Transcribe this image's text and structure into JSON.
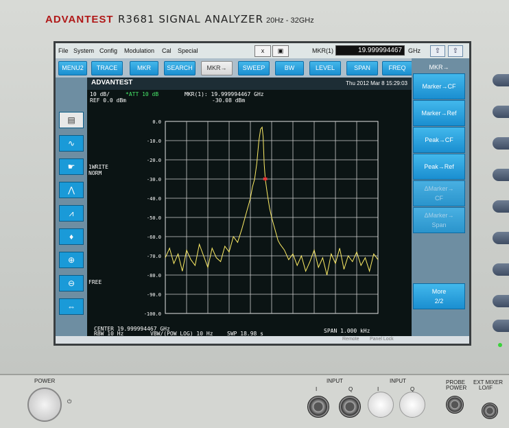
{
  "instrument": {
    "brand": "ADVANTEST",
    "model": "R3681  SIGNAL  ANALYZER",
    "freq_range": "20Hz - 32GHz"
  },
  "menubar": {
    "items": [
      "File",
      "System",
      "Config",
      "Modulation",
      "Cal",
      "Special"
    ],
    "close_label": "x",
    "save_label": "▣",
    "marker_label": "MKR(1)",
    "marker_value": "19.999994467",
    "marker_unit": "GHz",
    "arrow_left": "⇧",
    "arrow_right": "⇧"
  },
  "softkeys": [
    "MENU2",
    "TRACE",
    "MKR",
    "SEARCH",
    "MKR→",
    "SWEEP",
    "BW",
    "LEVEL",
    "SPAN",
    "FREQ"
  ],
  "right_panel": {
    "header": "MKR→",
    "keys": [
      "Marker→CF",
      "Marker→Ref",
      "Peak→CF",
      "Peak→Ref"
    ],
    "disabled_keys": [
      {
        "line1": "ΔMarker→",
        "line2": "CF"
      },
      {
        "line1": "ΔMarker→",
        "line2": "Span"
      }
    ],
    "more": {
      "line1": "More",
      "line2": "2/2"
    }
  },
  "display": {
    "logo": "ADVANTEST",
    "datetime": "Thu 2012 Mar 8 15:29:03",
    "scale": "10 dB/",
    "ref": "REF 0.0 dBm",
    "att": "*ATT 10 dB",
    "mkr_line1": "MKR(1): 19.999994467 GHz",
    "mkr_line2": "-30.08 dBm",
    "trace_mode_1": "1WRITE",
    "trace_mode_2": "NORM",
    "free": "FREE",
    "center": "CENTER 19.999994467 GHz",
    "rbw": "RBW 10 Hz",
    "vbw": "VBW/(POW_LOG) 10 Hz",
    "swp": "SWP 18.98 s",
    "span": "SPAN 1.000 kHz",
    "y_ticks": [
      "0.0",
      "-10.0",
      "-20.0",
      "-30.0",
      "-40.0",
      "-50.0",
      "-60.0",
      "-70.0",
      "-80.0",
      "-90.0",
      "-100.0"
    ]
  },
  "status_bar": {
    "remote": "Remote",
    "panel_lock": "Panel Lock"
  },
  "chart_data": {
    "type": "line",
    "x_ticks": [],
    "ylim": [
      -100,
      0
    ],
    "grid": true,
    "series_color": "#ffee66",
    "trace_points": [
      [
        0,
        -71
      ],
      [
        2,
        -66
      ],
      [
        4,
        -74
      ],
      [
        6,
        -69
      ],
      [
        8,
        -78
      ],
      [
        10,
        -67
      ],
      [
        12,
        -72
      ],
      [
        14,
        -75
      ],
      [
        16,
        -64
      ],
      [
        18,
        -70
      ],
      [
        20,
        -76
      ],
      [
        22,
        -66
      ],
      [
        24,
        -71
      ],
      [
        26,
        -73
      ],
      [
        28,
        -65
      ],
      [
        30,
        -68
      ],
      [
        32,
        -60
      ],
      [
        34,
        -63
      ],
      [
        36,
        -56
      ],
      [
        37,
        -52
      ],
      [
        38,
        -48
      ],
      [
        39,
        -44
      ],
      [
        40,
        -40
      ],
      [
        41,
        -34
      ],
      [
        42,
        -30
      ],
      [
        43,
        -22
      ],
      [
        44,
        -10
      ],
      [
        44.8,
        -4
      ],
      [
        45.5,
        -3
      ],
      [
        46,
        -8
      ],
      [
        46.5,
        -22
      ],
      [
        47,
        -30
      ],
      [
        48,
        -38
      ],
      [
        49,
        -45
      ],
      [
        50,
        -50
      ],
      [
        51,
        -54
      ],
      [
        52,
        -58
      ],
      [
        53,
        -62
      ],
      [
        54,
        -64
      ],
      [
        56,
        -67
      ],
      [
        58,
        -72
      ],
      [
        60,
        -69
      ],
      [
        62,
        -75
      ],
      [
        64,
        -70
      ],
      [
        66,
        -78
      ],
      [
        68,
        -73
      ],
      [
        70,
        -67
      ],
      [
        72,
        -76
      ],
      [
        74,
        -71
      ],
      [
        76,
        -80
      ],
      [
        78,
        -69
      ],
      [
        80,
        -74
      ],
      [
        82,
        -66
      ],
      [
        84,
        -77
      ],
      [
        86,
        -70
      ],
      [
        88,
        -73
      ],
      [
        90,
        -68
      ],
      [
        92,
        -75
      ],
      [
        94,
        -71
      ],
      [
        96,
        -78
      ],
      [
        98,
        -69
      ],
      [
        100,
        -72
      ]
    ],
    "marker": {
      "x": 47,
      "y": -30.08
    }
  },
  "panel": {
    "power": "POWER",
    "input_1": "INPUT",
    "input_2": "INPUT",
    "i_label": "I",
    "q_label": "Q",
    "i_label_2": "I",
    "q_label_2": "Q",
    "probe_power": "PROBE",
    "probe_power_2": "POWER",
    "ext_mixer": "EXT MIXER",
    "ext_mixer_2": "LO/IF"
  },
  "colors": {
    "softkey_blue": "#1a8fd0",
    "trace_yellow": "#ffee66",
    "brand_red": "#b01818"
  }
}
